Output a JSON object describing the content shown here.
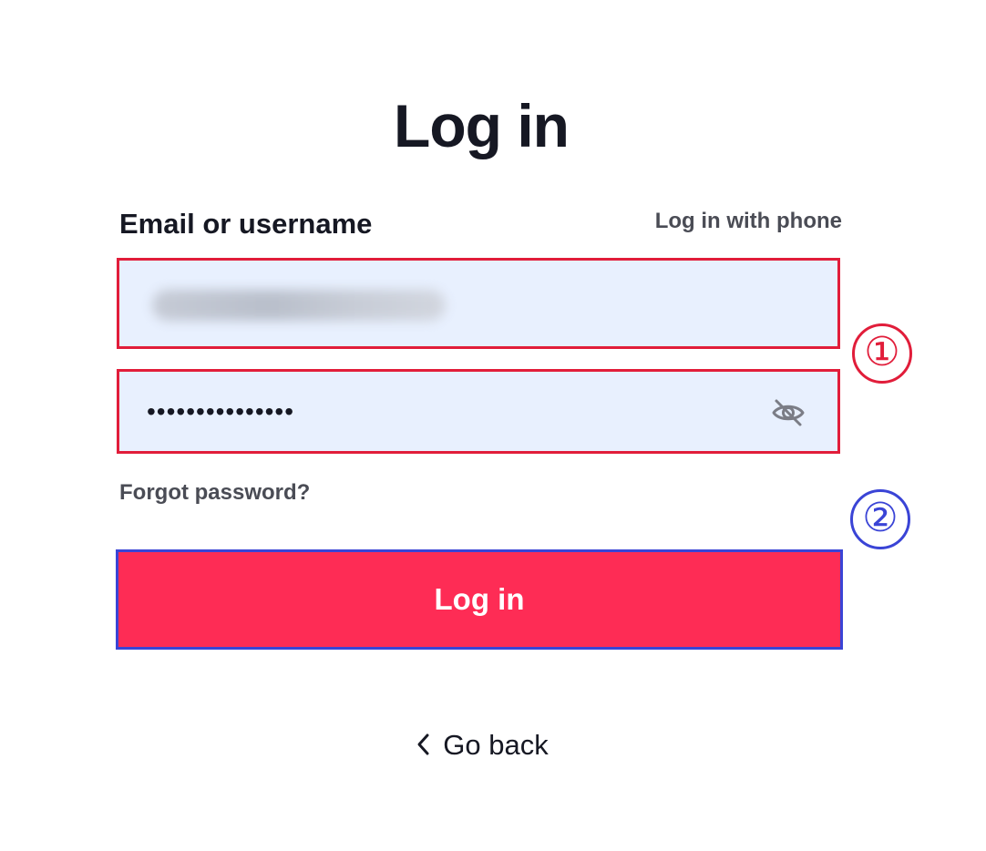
{
  "page": {
    "title": "Log in"
  },
  "form": {
    "email_label": "Email or username",
    "login_with_phone": "Log in with phone",
    "email_value_obscured": true,
    "password_masked": "•••••••••••••••",
    "forgot_password": "Forgot password?",
    "submit_label": "Log in",
    "go_back": "Go back"
  },
  "annotations": {
    "marker_1": "①",
    "marker_2": "②"
  },
  "colors": {
    "primary_button": "#fe2c55",
    "input_background": "#e8f0fe",
    "annotation_red": "#e11d3a",
    "annotation_blue": "#3a44d6",
    "text_dark": "#161823",
    "text_secondary": "#4a4c55"
  },
  "icons": {
    "password_toggle": "eye-slash-icon",
    "back": "chevron-left-icon"
  }
}
